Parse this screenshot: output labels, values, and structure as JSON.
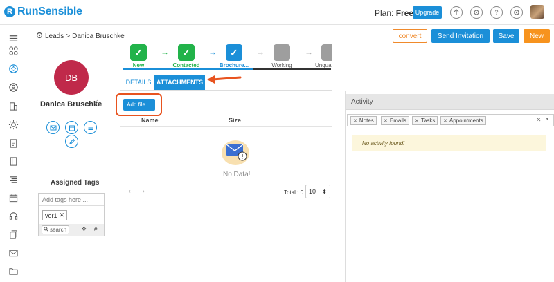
{
  "brand": {
    "logo_text": "RunSensible",
    "logo_mark": "R"
  },
  "topbar": {
    "plan_label": "Plan:",
    "plan_value": "Free",
    "upgrade_label": "Upgrade",
    "icons": [
      "upload-icon",
      "support-icon",
      "help-icon",
      "settings-icon"
    ]
  },
  "nav": {
    "icons": [
      "menu-icon",
      "grid-icon",
      "dashboard-icon",
      "contacts-icon",
      "building-icon",
      "idea-icon",
      "document-icon",
      "book-icon",
      "list-icon",
      "calendar-icon",
      "headset-icon",
      "invoice-icon",
      "mail-icon",
      "folder-icon"
    ]
  },
  "breadcrumb": {
    "root": "Leads",
    "separator": ">",
    "current": "Danica Bruschke"
  },
  "actions": {
    "convert": "convert",
    "send_invitation": "Send Invitation",
    "save": "Save",
    "new": "New"
  },
  "contact": {
    "initials": "DB",
    "name": "Danica Bruschke",
    "avatar_color": "#c0294a",
    "assigned_tags_title": "Assigned Tags",
    "tags_placeholder": "Add tags here ...",
    "tags": [
      "ver1"
    ],
    "search_placeholder": "search"
  },
  "pipeline": {
    "stages": [
      {
        "label": "New",
        "status": "done"
      },
      {
        "label": "Contacted",
        "status": "done"
      },
      {
        "label": "Brochure...",
        "status": "current"
      },
      {
        "label": "Working",
        "status": "pending"
      },
      {
        "label": "Unqua",
        "status": "pending"
      }
    ]
  },
  "tabs": {
    "details": "DETAILS",
    "attachments": "ATTACHMENTS"
  },
  "attachments": {
    "add_file": "Add file ...",
    "columns": [
      "Name",
      "Size"
    ],
    "empty_text": "No Data!",
    "pager_prev": "‹",
    "pager_next": "›",
    "total_label": "Total : 0",
    "page_size": "10"
  },
  "activity": {
    "title": "Activity",
    "filters": [
      "Notes",
      "Emails",
      "Tasks",
      "Appointments"
    ],
    "empty_text": "No activity found!"
  },
  "colors": {
    "primary": "#1b8fd8",
    "orange": "#f7931e",
    "highlight": "#e8531f",
    "done": "#22b34a"
  }
}
